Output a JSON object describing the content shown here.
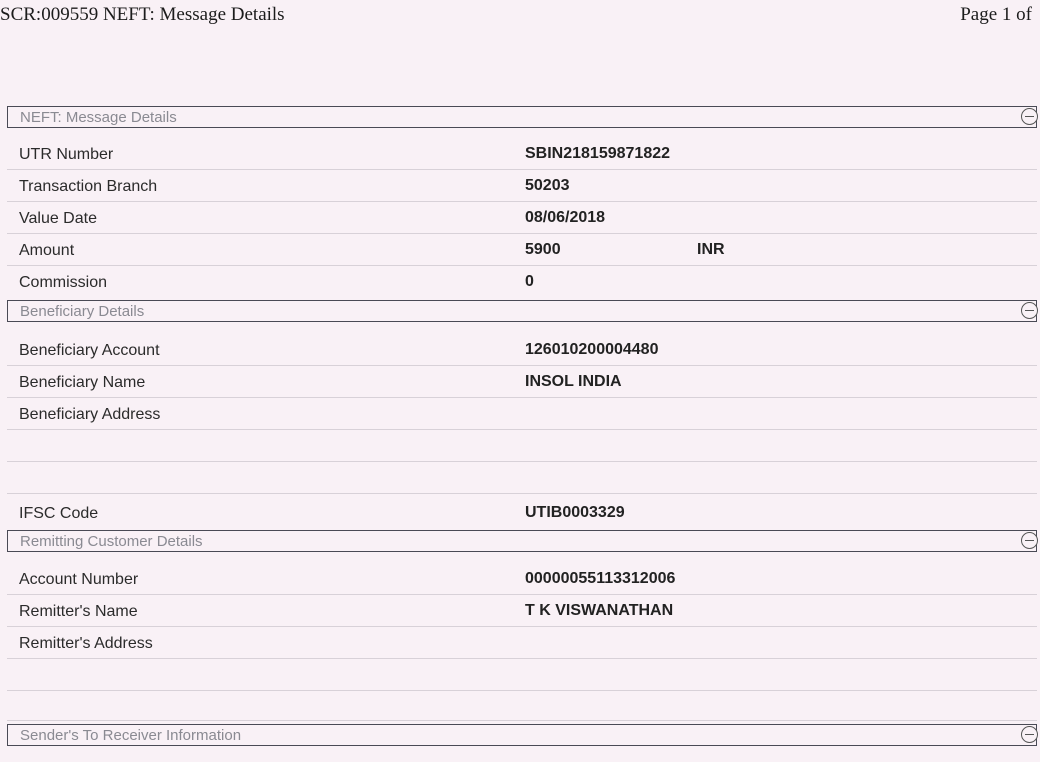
{
  "page": {
    "header_left": "SCR:009559 NEFT: Message Details",
    "header_right": "Page 1 of"
  },
  "sections": {
    "message": {
      "title": "NEFT: Message Details",
      "rows": {
        "utr": {
          "label": "UTR Number",
          "value": "SBIN218159871822"
        },
        "branch": {
          "label": "Transaction Branch",
          "value": "50203"
        },
        "value_date": {
          "label": "Value Date",
          "value": "08/06/2018"
        },
        "amount": {
          "label": "Amount",
          "value": "5900",
          "currency": "INR"
        },
        "commission": {
          "label": "Commission",
          "value": "0"
        }
      }
    },
    "beneficiary": {
      "title": "Beneficiary Details",
      "rows": {
        "account": {
          "label": "Beneficiary Account",
          "value": "126010200004480"
        },
        "name": {
          "label": "Beneficiary Name",
          "value": "INSOL INDIA"
        },
        "address": {
          "label": "Beneficiary Address",
          "value": ""
        },
        "ifsc": {
          "label": "IFSC Code",
          "value": "UTIB0003329"
        }
      }
    },
    "remitter": {
      "title": "Remitting Customer Details",
      "rows": {
        "account": {
          "label": "Account Number",
          "value": "00000055113312006"
        },
        "name": {
          "label": "Remitter's Name",
          "value": "T K VISWANATHAN"
        },
        "address": {
          "label": "Remitter's Address",
          "value": ""
        }
      }
    },
    "sender_info": {
      "title": "Sender's To Receiver Information"
    }
  }
}
